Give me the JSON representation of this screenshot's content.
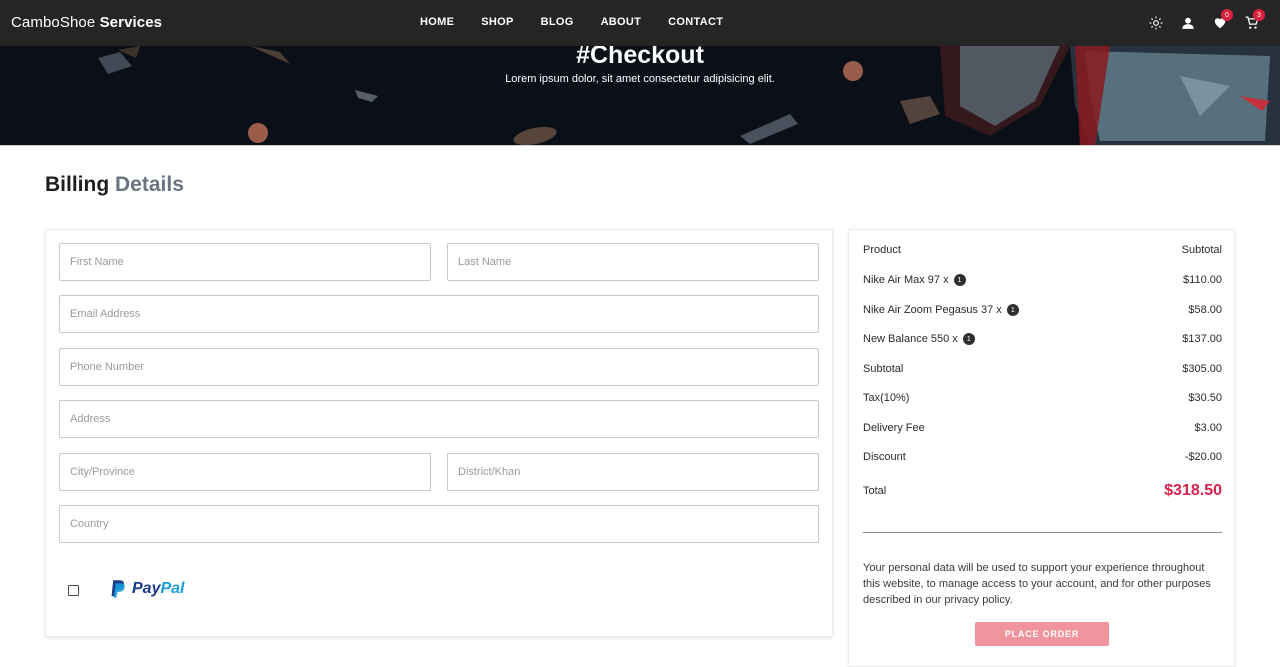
{
  "navbar": {
    "brand_light": "CamboShoe",
    "brand_bold": "Services",
    "links": [
      "HOME",
      "SHOP",
      "BLOG",
      "ABOUT",
      "CONTACT"
    ],
    "wishlist_count": "0",
    "cart_count": "3",
    "icons": [
      "theme-toggle-icon",
      "user-icon",
      "heart-icon",
      "cart-icon"
    ]
  },
  "hero": {
    "title": "#Checkout",
    "subtitle": "Lorem ipsum dolor, sit amet consectetur adipisicing elit."
  },
  "billing": {
    "title_dark": "Billing",
    "title_light": "Details",
    "fields": {
      "first_name": "First Name",
      "last_name": "Last Name",
      "email": "Email Address",
      "phone": "Phone Number",
      "address": "Address",
      "city": "City/Province",
      "district": "District/Khan",
      "country": "Country"
    },
    "payment": {
      "pay": "Pay",
      "pal": "Pal"
    }
  },
  "order": {
    "header_product": "Product",
    "header_subtotal": "Subtotal",
    "items": [
      {
        "name": "Nike Air Max 97 x",
        "qty": "1",
        "price": "$110.00"
      },
      {
        "name": "Nike Air Zoom Pegasus 37 x",
        "qty": "1",
        "price": "$58.00"
      },
      {
        "name": "New Balance 550 x",
        "qty": "1",
        "price": "$137.00"
      }
    ],
    "subtotal_label": "Subtotal",
    "subtotal_value": "$305.00",
    "tax_label": "Tax(10%)",
    "tax_value": "$30.50",
    "delivery_label": "Delivery Fee",
    "delivery_value": "$3.00",
    "discount_label": "Discount",
    "discount_value": "-$20.00",
    "total_label": "Total",
    "total_value": "$318.50",
    "privacy_text": "Your personal data will be used to support your experience throughout this website, to manage access to your account, and for other purposes described in our privacy policy.",
    "place_order_label": "PLACE ORDER"
  },
  "colors": {
    "navbar_bg": "#252525",
    "accent_total": "#d6224d",
    "place_order_bg": "#f0959e",
    "badge": "#d9213e"
  }
}
